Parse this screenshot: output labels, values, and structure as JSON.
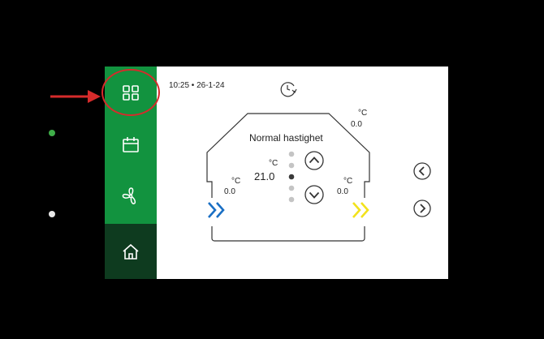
{
  "header": {
    "datetime": "10:25 • 26-1-24"
  },
  "sidebar": {
    "items": [
      {
        "name": "dashboard",
        "icon": "grid-icon",
        "active": false,
        "highlighted": true
      },
      {
        "name": "schedule",
        "icon": "calendar-icon",
        "active": false
      },
      {
        "name": "fan",
        "icon": "fan-icon",
        "active": false
      },
      {
        "name": "home",
        "icon": "home-icon",
        "active": true
      }
    ]
  },
  "house": {
    "mode_title": "Normal hastighet",
    "outdoor": {
      "unit": "°C",
      "value": "0.0"
    },
    "indoor": {
      "unit": "°C",
      "value": "21.0"
    },
    "supply": {
      "unit": "°C",
      "value": "0.0"
    },
    "extract": {
      "unit": "°C",
      "value": "0.0"
    },
    "fan_level": {
      "total": 5,
      "current": 3
    }
  },
  "indicators": {
    "led_top": "green",
    "led_bottom": "white"
  },
  "colors": {
    "sidebar": "#12933f",
    "sidebar_active": "#0e3b1f",
    "highlight": "#d62b2b",
    "arrow_in": "#1a6fc4",
    "arrow_out": "#f2e21c"
  }
}
